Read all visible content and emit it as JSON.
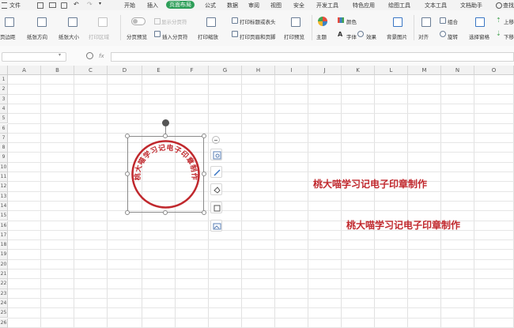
{
  "menubar": {
    "file_label": "文件",
    "items": [
      "开始",
      "插入",
      "页面布局",
      "公式",
      "数据",
      "审阅",
      "视图",
      "安全",
      "开发工具",
      "特色应用",
      "绘图工具",
      "文本工具",
      "文档助手",
      "查找"
    ]
  },
  "ribbon": {
    "margins": "页边距",
    "orientation": "纸张方向",
    "size": "纸张大小",
    "print_area": "打印区域",
    "page_break_preview": "分页预览",
    "show_page_breaks": "显示分页符",
    "insert_page_break": "插入分页符",
    "print_scale": "打印缩放",
    "print_titles": "打印标题或表头",
    "print_header_footer": "打印页眉和页脚",
    "print_preview": "打印预览",
    "theme": "主题",
    "colors": "颜色",
    "fonts": "字体",
    "effects": "效果",
    "background": "背景图片",
    "align": "对齐",
    "group": "组合",
    "rotate": "旋转",
    "selection_pane": "选择窗格",
    "move_up": "上移",
    "move_down": "下移"
  },
  "formula_bar": {
    "fx": "fx"
  },
  "columns": [
    "A",
    "B",
    "C",
    "D",
    "E",
    "F",
    "G",
    "H",
    "I",
    "J",
    "K",
    "L",
    "M",
    "N",
    "O"
  ],
  "rows": [
    "1",
    "2",
    "3",
    "4",
    "5",
    "6",
    "7",
    "8",
    "9",
    "10",
    "11",
    "12",
    "13",
    "14",
    "15",
    "16",
    "17",
    "18",
    "19",
    "20",
    "21",
    "22",
    "23",
    "24",
    "25",
    "26"
  ],
  "seal": {
    "text": "桃大喵学习记电子印章制作",
    "color": "#c0282d"
  },
  "cells": {
    "text1": "桃大喵学习记电子印章制作",
    "text2": "桃大喵学习记电子印章制作"
  }
}
